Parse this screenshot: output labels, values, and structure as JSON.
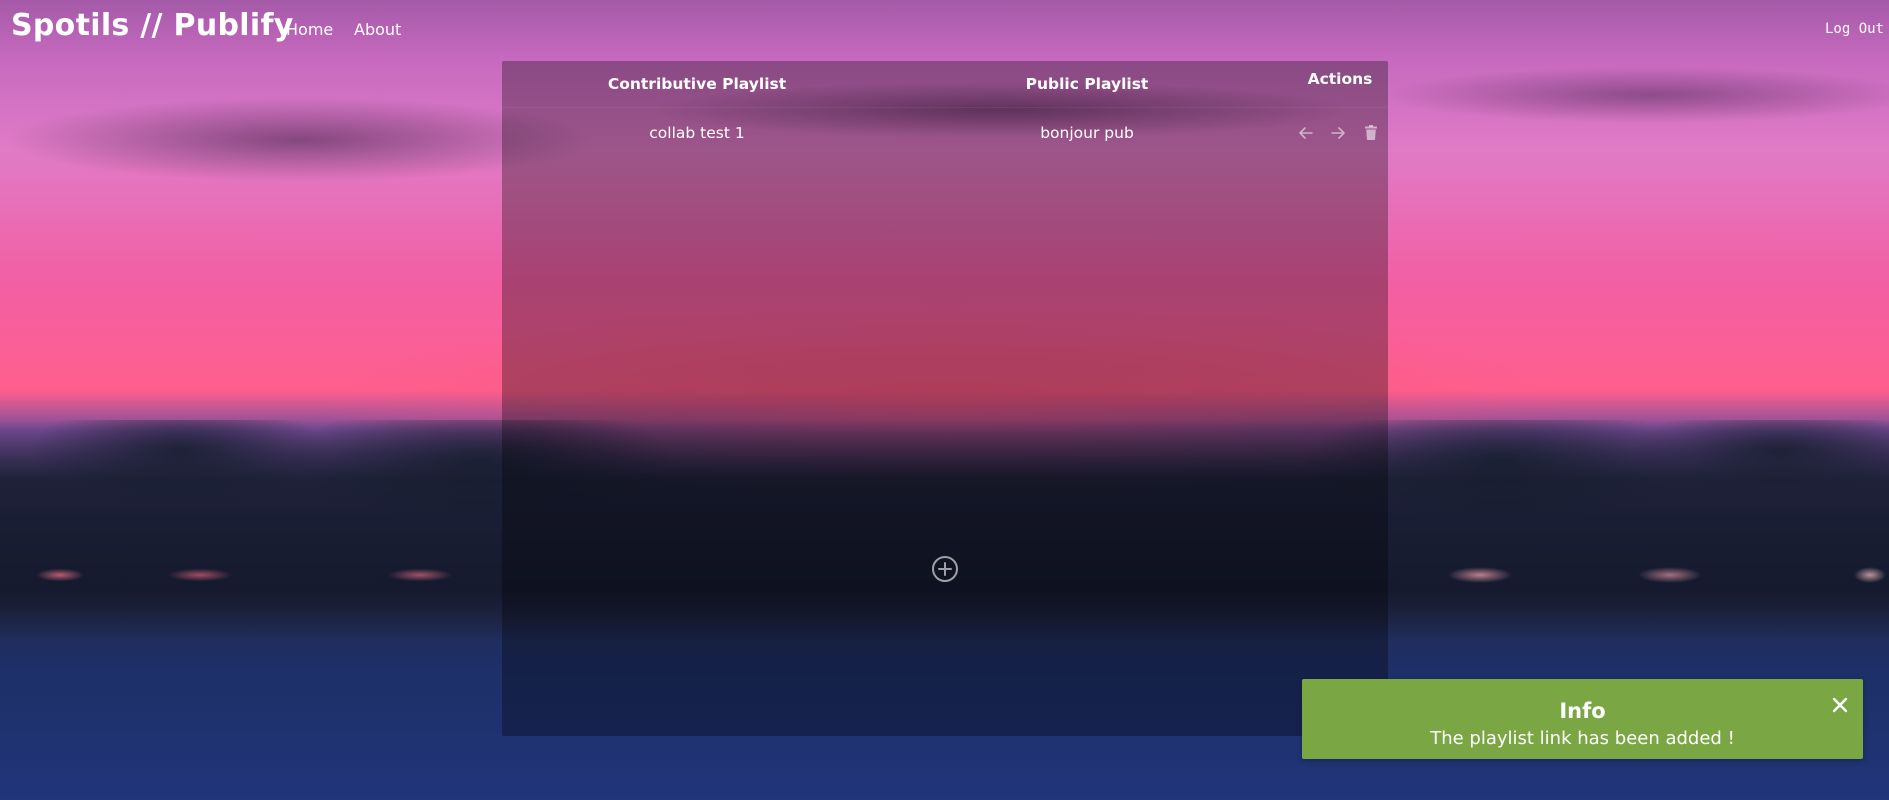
{
  "navbar": {
    "brand": "Spotils // Publify",
    "links": [
      {
        "label": "Home"
      },
      {
        "label": "About"
      }
    ],
    "logout_label": "Log Out"
  },
  "table": {
    "headers": {
      "contributive": "Contributive Playlist",
      "public": "Public Playlist",
      "actions": "Actions"
    },
    "rows": [
      {
        "contributive": "collab test 1",
        "public": "bonjour pub",
        "actions": [
          "arrow-left-icon",
          "arrow-right-icon",
          "trash-icon"
        ]
      }
    ],
    "add_button_icon": "plus-circle-icon"
  },
  "toast": {
    "title": "Info",
    "message": "The playlist link has been added !",
    "color": "#7aa744",
    "close_icon": "close-icon"
  }
}
